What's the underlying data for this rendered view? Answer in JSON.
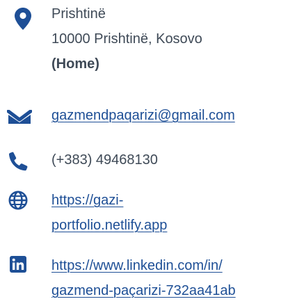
{
  "accent_color": "#1e4f96",
  "text_color": "#3f4a57",
  "contact": {
    "address": {
      "icon": "location-pin-icon",
      "line1": "Prishtinë",
      "line2": "10000 Prishtinë, Kosovo",
      "line3": "(Home)"
    },
    "email": {
      "icon": "envelope-icon",
      "value": "gazmendpaqarizi@gmail.com"
    },
    "phone": {
      "icon": "phone-icon",
      "value": "(+383) 49468130"
    },
    "website": {
      "icon": "globe-icon",
      "line1": "https://gazi-",
      "line2": "portfolio.netlify.app"
    },
    "linkedin": {
      "icon": "linkedin-icon",
      "line1": "https://www.linkedin.com/in/",
      "line2": "gazmend-paçarizi-732aa41ab"
    }
  }
}
